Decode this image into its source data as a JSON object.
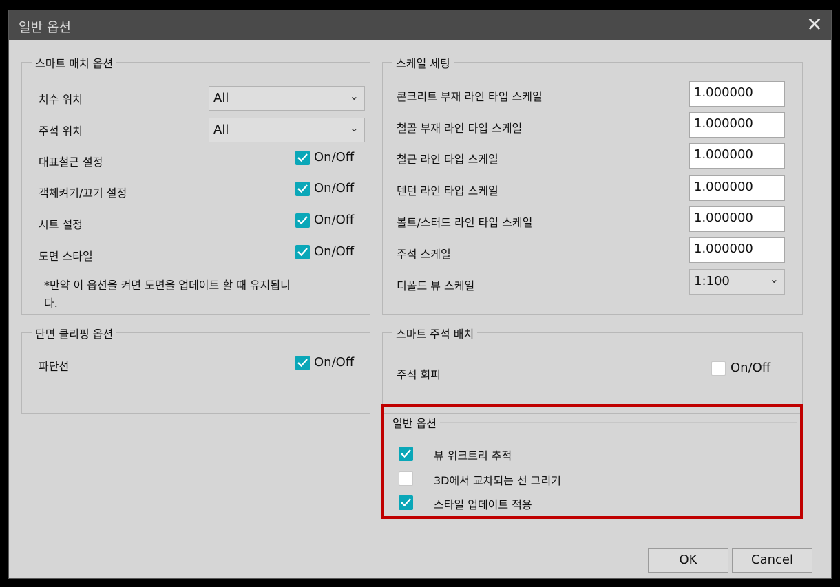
{
  "window": {
    "title": "일반 옵션",
    "close_symbol": "✕"
  },
  "smart_match": {
    "legend": "스마트 매치 옵션",
    "dim_position": {
      "label": "치수 위치",
      "value": "All"
    },
    "note_position": {
      "label": "주석 위치",
      "value": "All"
    },
    "toggles": [
      {
        "label": "대표철근 설정",
        "toggle": "On/Off",
        "checked": true
      },
      {
        "label": "객체켜기/끄기 설정",
        "toggle": "On/Off",
        "checked": true
      },
      {
        "label": "시트 설정",
        "toggle": "On/Off",
        "checked": true
      },
      {
        "label": "도면 스타일",
        "toggle": "On/Off",
        "checked": true
      }
    ],
    "note_line1": "*만약 이 옵션을 켜면 도면을 업데이트 할 때 유지됩니",
    "note_line2": "다."
  },
  "section_clip": {
    "legend": "단면 클리핑 옵션",
    "break_line": {
      "label": "파단선",
      "toggle": "On/Off",
      "checked": true
    }
  },
  "scale_settings": {
    "legend": "스케일 세팅",
    "rows": [
      {
        "label": "콘크리트 부재 라인 타입 스케일",
        "value": "1.000000"
      },
      {
        "label": "철골 부재 라인 타입 스케일",
        "value": "1.000000"
      },
      {
        "label": "철근 라인 타입 스케일",
        "value": "1.000000"
      },
      {
        "label": "텐던 라인 타입 스케일",
        "value": "1.000000"
      },
      {
        "label": "볼트/스터드 라인 타입 스케일",
        "value": "1.000000"
      },
      {
        "label": "주석 스케일",
        "value": "1.000000"
      }
    ],
    "default_view": {
      "label": "디폴드 뷰 스케일",
      "value": "1:100"
    }
  },
  "smart_note": {
    "legend": "스마트 주석 배치",
    "avoid": {
      "label": "주석 회피",
      "toggle": "On/Off",
      "checked": false
    }
  },
  "general": {
    "legend": "일반 옵션",
    "options": [
      {
        "label": "뷰 워크트리 추적",
        "checked": true
      },
      {
        "label": "3D에서 교차되는 선 그리기",
        "checked": false
      },
      {
        "label": "스타일 업데이트 적용",
        "checked": true
      }
    ]
  },
  "buttons": {
    "ok": "OK",
    "cancel": "Cancel"
  },
  "colors": {
    "check_accent": "#0aa7b8",
    "highlight": "#c00000",
    "titlebar": "#4a4a4a"
  }
}
